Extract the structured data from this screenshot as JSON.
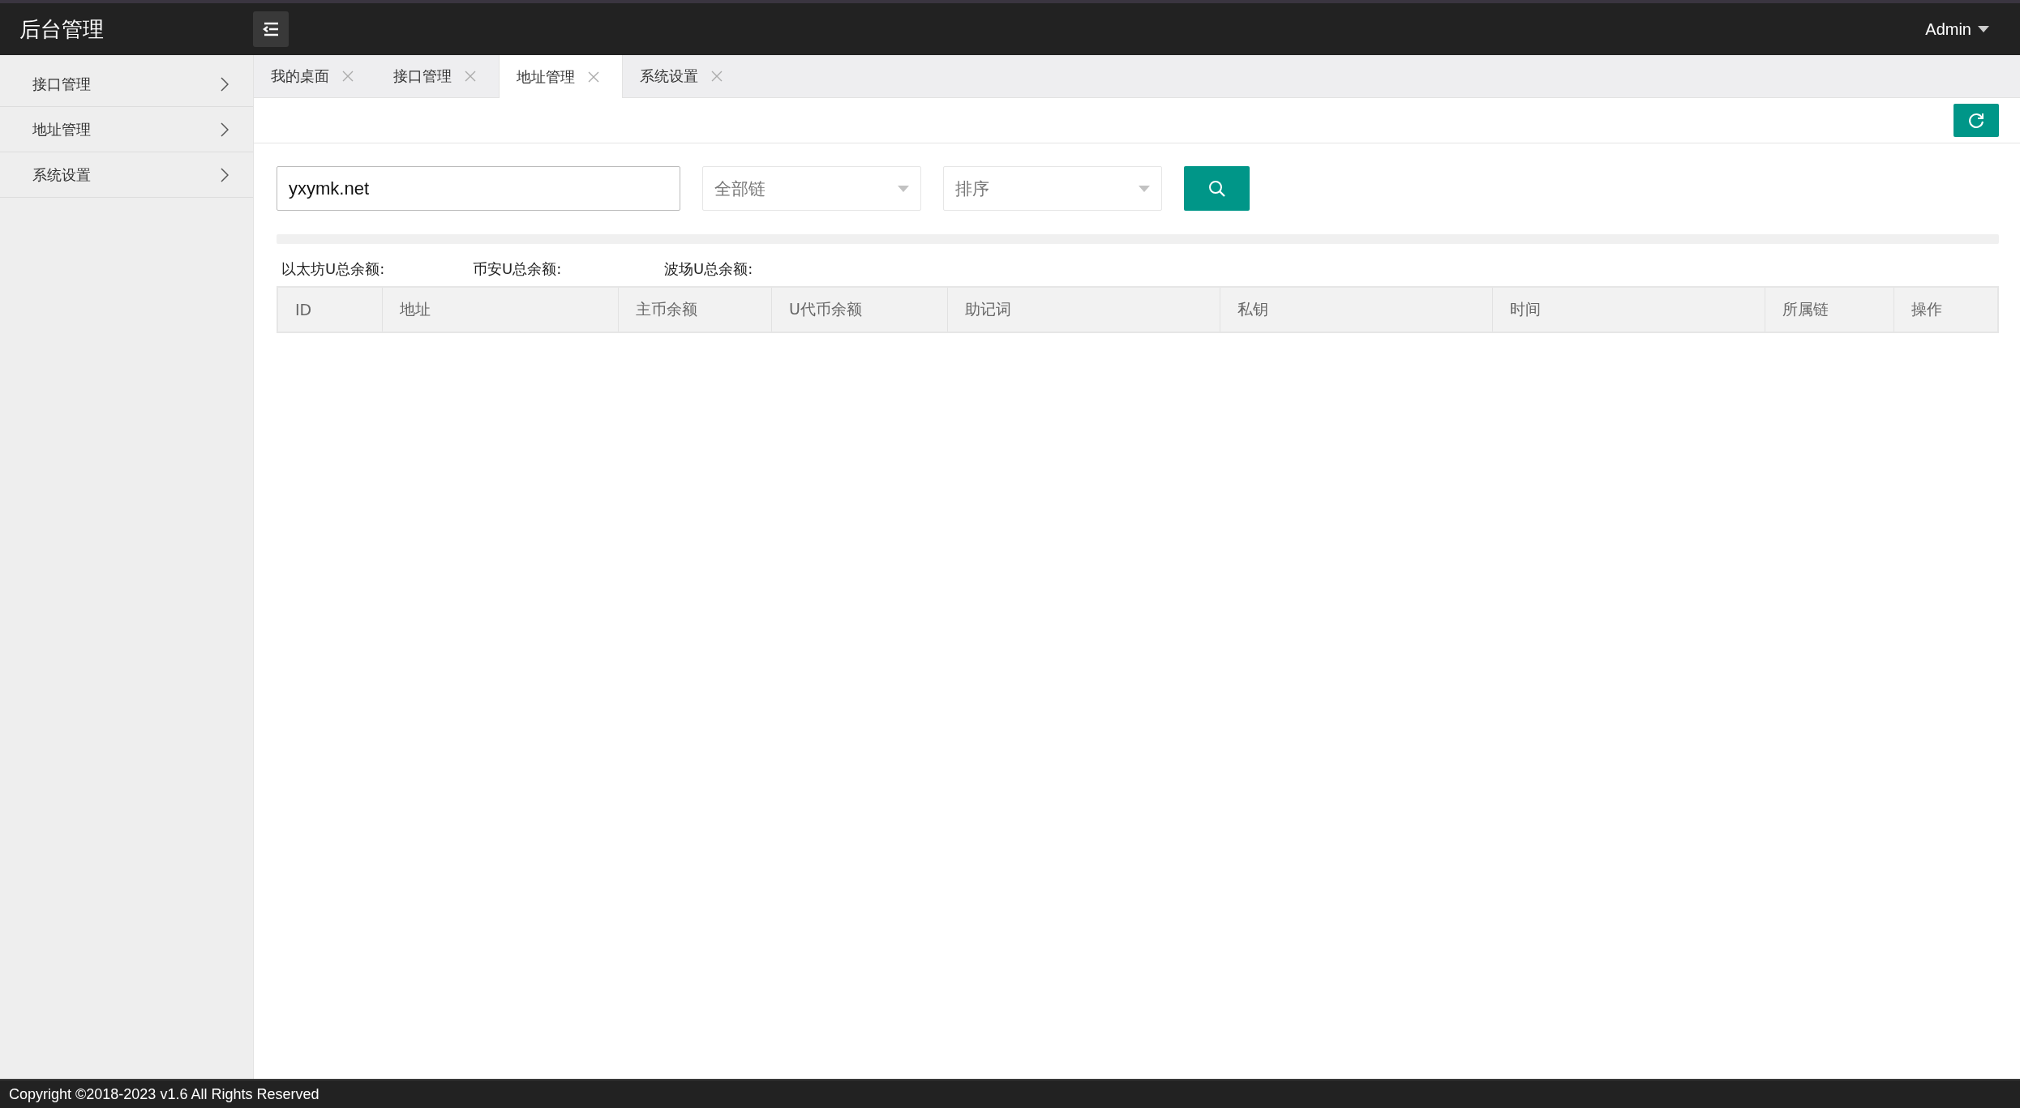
{
  "header": {
    "title": "后台管理",
    "user": "Admin"
  },
  "sidebar": {
    "items": [
      {
        "label": "接口管理"
      },
      {
        "label": "地址管理"
      },
      {
        "label": "系统设置"
      }
    ]
  },
  "tabs": [
    {
      "label": "我的桌面",
      "selected": false
    },
    {
      "label": "接口管理",
      "selected": false
    },
    {
      "label": "地址管理",
      "selected": true
    },
    {
      "label": "系统设置",
      "selected": false
    }
  ],
  "filters": {
    "search": {
      "value": "yxymk.net"
    },
    "chain_select": {
      "placeholder": "全部链"
    },
    "sort_select": {
      "placeholder": "排序"
    }
  },
  "summary": [
    "以太坊U总余额:",
    "币安U总余额:",
    "波场U总余额:"
  ],
  "table": {
    "columns": [
      "ID",
      "地址",
      "主币余额",
      "U代币余额",
      "助记词",
      "私钥",
      "时间",
      "所属链",
      "操作"
    ]
  },
  "footer": {
    "text": "Copyright ©2018-2023 v1.6 All Rights Reserved"
  }
}
